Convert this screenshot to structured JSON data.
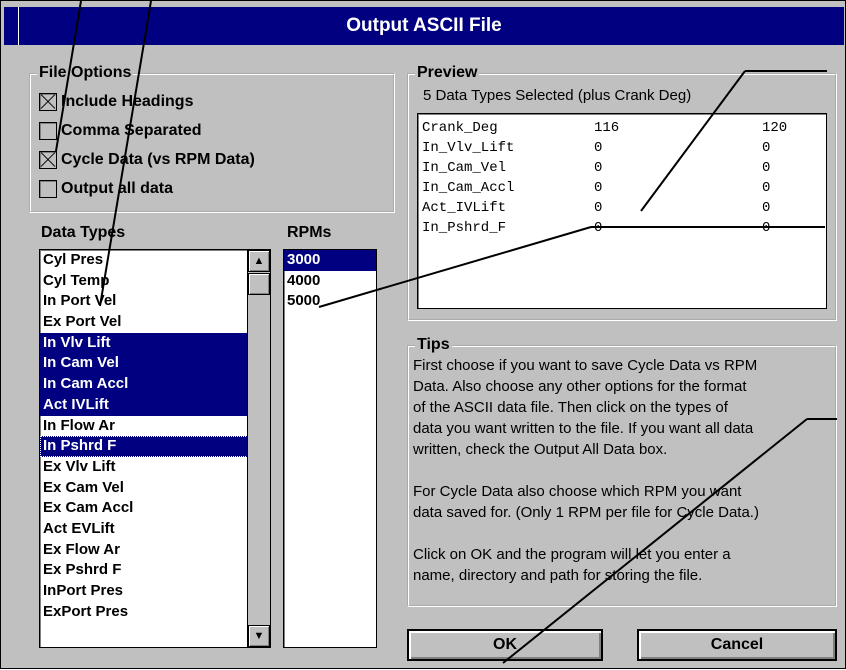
{
  "window": {
    "title": "Output ASCII File"
  },
  "file_options": {
    "label": "File Options",
    "items": [
      {
        "label": "Include Headings",
        "checked": true
      },
      {
        "label": "Comma Separated",
        "checked": false
      },
      {
        "label": "Cycle Data (vs RPM Data)",
        "checked": true
      },
      {
        "label": "Output all data",
        "checked": false
      }
    ]
  },
  "data_types": {
    "label": "Data Types",
    "items": [
      {
        "label": "Cyl Pres",
        "selected": false
      },
      {
        "label": "Cyl Temp",
        "selected": false
      },
      {
        "label": "In Port Vel",
        "selected": false
      },
      {
        "label": "Ex Port Vel",
        "selected": false
      },
      {
        "label": "In Vlv Lift",
        "selected": true
      },
      {
        "label": "In Cam Vel",
        "selected": true
      },
      {
        "label": "In Cam Accl",
        "selected": true
      },
      {
        "label": "Act IVLift",
        "selected": true
      },
      {
        "label": "In Flow Ar",
        "selected": false
      },
      {
        "label": "In Pshrd F",
        "selected": true
      },
      {
        "label": "Ex Vlv Lift",
        "selected": false
      },
      {
        "label": "Ex Cam Vel",
        "selected": false
      },
      {
        "label": "Ex Cam Accl",
        "selected": false
      },
      {
        "label": "Act EVLift",
        "selected": false
      },
      {
        "label": "Ex Flow Ar",
        "selected": false
      },
      {
        "label": "Ex Pshrd F",
        "selected": false
      },
      {
        "label": "InPort Pres",
        "selected": false
      },
      {
        "label": "ExPort Pres",
        "selected": false
      }
    ]
  },
  "rpms": {
    "label": "RPMs",
    "items": [
      {
        "label": "3000",
        "selected": true
      },
      {
        "label": "4000",
        "selected": false
      },
      {
        "label": "5000",
        "selected": false
      }
    ]
  },
  "preview": {
    "label": "Preview",
    "summary": "5 Data Types Selected (plus Crank Deg)",
    "rows": [
      {
        "name": "Crank_Deg",
        "v1": "116",
        "v2": "120"
      },
      {
        "name": "In_Vlv_Lift",
        "v1": "0",
        "v2": "0"
      },
      {
        "name": "In_Cam_Vel",
        "v1": "0",
        "v2": "0"
      },
      {
        "name": "In_Cam_Accl",
        "v1": "0",
        "v2": "0"
      },
      {
        "name": "Act_IVLift",
        "v1": "0",
        "v2": "0"
      },
      {
        "name": "In_Pshrd_F",
        "v1": "0",
        "v2": "0"
      }
    ]
  },
  "tips": {
    "label": "Tips",
    "lines": [
      "First choose if you want to save Cycle Data vs RPM",
      "Data.  Also choose any other options for the format",
      "of the ASCII data file.  Then click on the types of",
      "data you want written to the file.  If you want all data",
      "written, check the Output All Data box.",
      "",
      "For Cycle Data also choose which RPM you want",
      "data saved for. (Only 1 RPM per file for Cycle Data.)",
      "",
      "Click on OK and the program will let you enter a",
      "name, directory and path for storing the file."
    ]
  },
  "buttons": {
    "ok": "OK",
    "cancel": "Cancel"
  },
  "scroll": {
    "up_icon": "▲",
    "down_icon": "▼"
  },
  "colors": {
    "face": "#c0c0c0",
    "selection": "#000080",
    "title": "#000080"
  }
}
